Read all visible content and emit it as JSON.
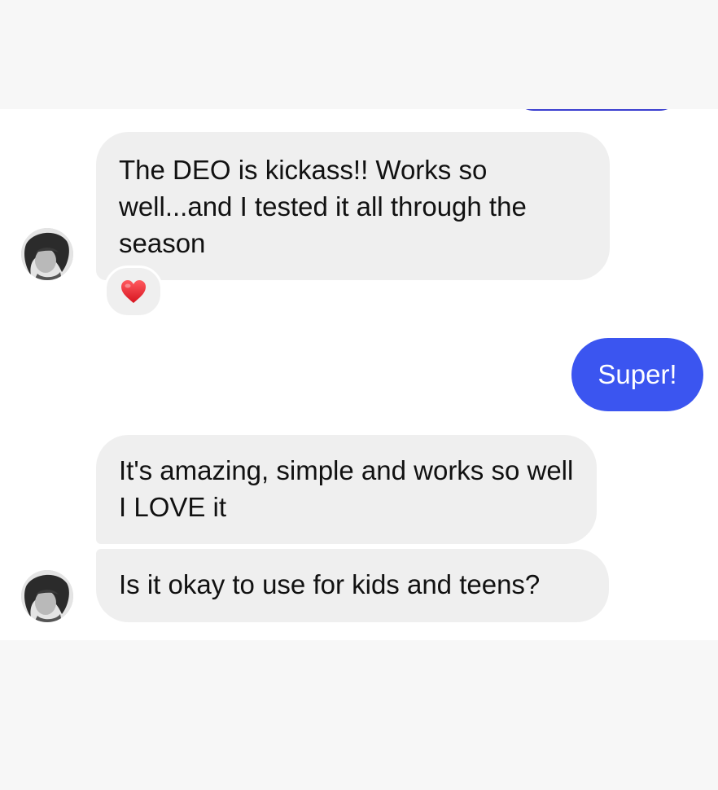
{
  "conversation": {
    "messages": [
      {
        "sender": "contact",
        "text": "The DEO is kickass!! Works so well...and I tested it all through the season",
        "reaction": "heart"
      },
      {
        "sender": "me",
        "text": "Super!"
      },
      {
        "sender": "contact",
        "text": "It's amazing, simple and works so well I LOVE it"
      },
      {
        "sender": "contact",
        "text": "Is it okay to use for kids and teens?"
      }
    ]
  },
  "icons": {
    "reaction": "heart-icon",
    "avatar": "contact-avatar"
  },
  "colors": {
    "incoming_bubble": "#efefef",
    "outgoing_bubble": "#3b55f0",
    "outgoing_text": "#ffffff",
    "heart": "#e0202a",
    "chat_background": "#ffffff",
    "frame_background": "#f7f7f7"
  }
}
